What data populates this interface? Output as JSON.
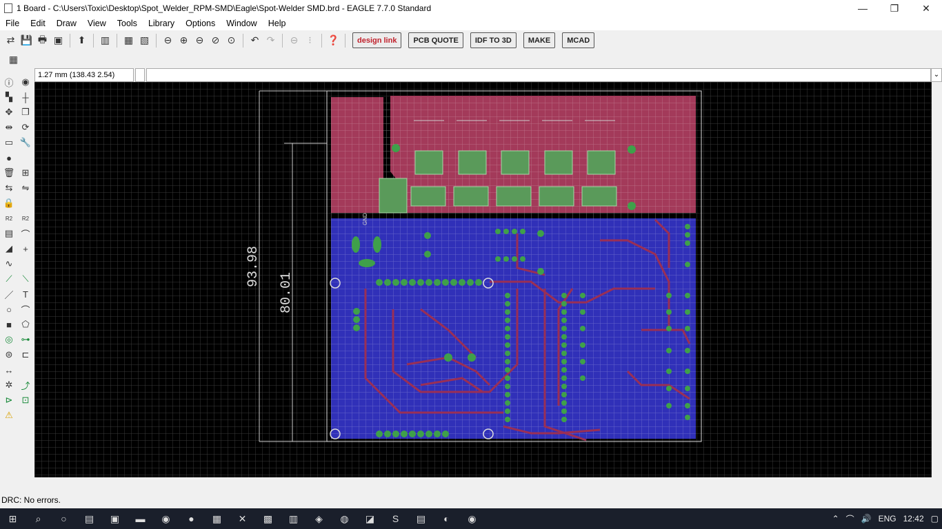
{
  "window": {
    "title": "1 Board - C:\\Users\\Toxic\\Desktop\\Spot_Welder_RPM-SMD\\Eagle\\Spot-Welder SMD.brd - EAGLE 7.7.0 Standard",
    "minimize": "—",
    "restore": "❐",
    "close": "✕"
  },
  "menu": [
    "File",
    "Edit",
    "Draw",
    "View",
    "Tools",
    "Library",
    "Options",
    "Window",
    "Help"
  ],
  "toolbar": {
    "designlink": "design link",
    "pcbquote": "PCB QUOTE",
    "idfto3d": "IDF TO 3D",
    "make": "MAKE",
    "mcad": "MCAD"
  },
  "command": {
    "coords": "1.27 mm (138.43 2.54)",
    "value": "",
    "dropdown": "⌄"
  },
  "canvas": {
    "dim_outer": "93.98",
    "dim_inner": "80.01",
    "gnd_label": "GND"
  },
  "status": {
    "drc": "DRC: No errors."
  },
  "taskbar": {
    "lang": "ENG",
    "time": "12:42"
  },
  "colors": {
    "top_copper": "#a33a5a",
    "bottom_copper": "#3030b8",
    "pads": "#3fa04a",
    "trace": "#9a2f55",
    "grid": "#3a3a3a",
    "background": "#000000"
  }
}
